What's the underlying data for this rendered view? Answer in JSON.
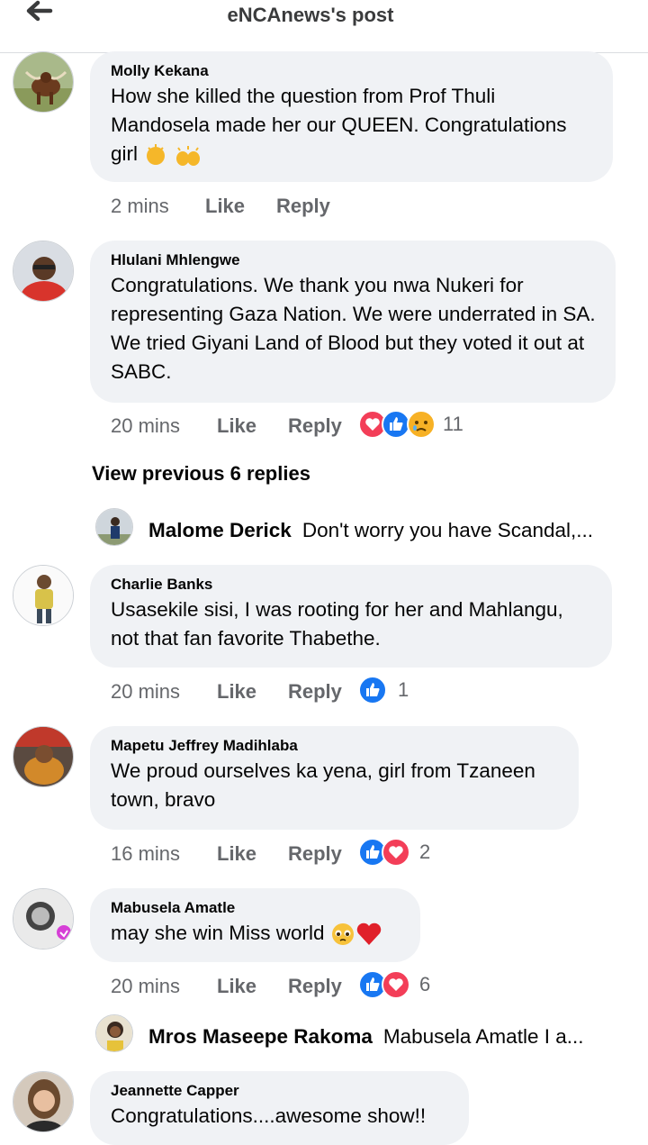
{
  "header": {
    "title": "eNCAnews's post"
  },
  "actions": {
    "like": "Like",
    "reply": "Reply"
  },
  "comments": [
    {
      "author": "Molly Kekana",
      "text": "How she killed the question from Prof Thuli Mandosela made her our QUEEN. Congratulations girl",
      "time": "2 mins",
      "reaction_count": ""
    },
    {
      "author": "Hlulani Mhlengwe",
      "text": "Congratulations. We thank you nwa Nukeri for representing Gaza Nation. We were underrated in SA. We tried Giyani Land of Blood but they voted it out at SABC.",
      "time": "20 mins",
      "reaction_count": "11",
      "reactions": [
        "love-icon",
        "like-icon",
        "sad-icon"
      ]
    },
    {
      "author": "Charlie Banks",
      "text": "Usasekile sisi, I was rooting for her and Mahlangu, not that fan favorite Thabethe.",
      "time": "20 mins",
      "reaction_count": "1",
      "reactions": [
        "like-icon"
      ]
    },
    {
      "author": "Mapetu Jeffrey Madihlaba",
      "text": "We proud ourselves ka yena, girl from Tzaneen town, bravo",
      "time": "16 mins",
      "reaction_count": "2",
      "reactions": [
        "like-icon",
        "love-icon"
      ]
    },
    {
      "author": "Mabusela Amatle",
      "text": "may she win Miss world",
      "time": "20 mins",
      "reaction_count": "6",
      "reactions": [
        "like-icon",
        "love-icon"
      ]
    },
    {
      "author": "Jeannette Capper",
      "text": "Congratulations....awesome show!!",
      "time": "",
      "reaction_count": ""
    }
  ],
  "view_previous": "View previous 6 replies",
  "reply_previews": [
    {
      "author": "Malome Derick",
      "text": "Don't worry you have Scandal,..."
    },
    {
      "author": "Mros Maseepe Rakoma",
      "text": "Mabusela Amatle I a..."
    }
  ],
  "colors": {
    "bubble": "#f0f2f5",
    "meta": "#65676b",
    "like": "#1877f2",
    "love": "#f33e58"
  }
}
